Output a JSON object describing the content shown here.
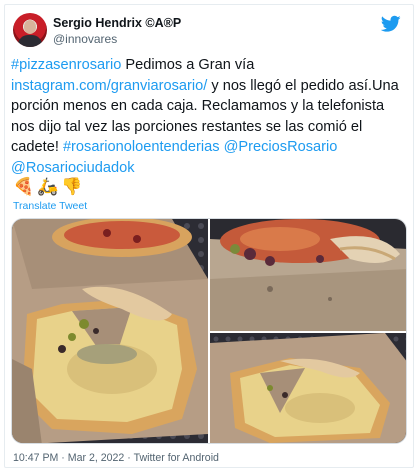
{
  "author": {
    "display_name": "Sergio Hendrix ©A®P",
    "handle": "@innovares"
  },
  "tweet": {
    "hashtag_pizza": "#pizzasenrosario",
    "text_1": " Pedimos a Gran vía ",
    "link_instagram": "instagram.com/granviarosario/",
    "text_2": " y nos llegó el pedido así.Una porción menos en cada caja.  Reclamamos y la telefonista nos dijo tal vez las porciones restantes se las comió el cadete! ",
    "hashtag_rosario": "#rosarionoloentenderias",
    "mention_precios": "@PreciosRosario",
    "mention_ciudad": "@Rosariociudadok",
    "emojis": [
      "🍕",
      "🛵",
      "👎"
    ],
    "translate_label": "Translate Tweet"
  },
  "media": {
    "photos": [
      "pizza-box-left",
      "pizza-box-top-right",
      "pizza-box-bottom-right"
    ]
  },
  "meta": {
    "time": "10:47 PM",
    "separator": " · ",
    "date": "Mar 2, 2022",
    "source": "Twitter for Android"
  },
  "colors": {
    "link": "#1d9bf0",
    "brand": "#1d9bf0",
    "text": "#0f1419",
    "secondary": "#536471"
  }
}
